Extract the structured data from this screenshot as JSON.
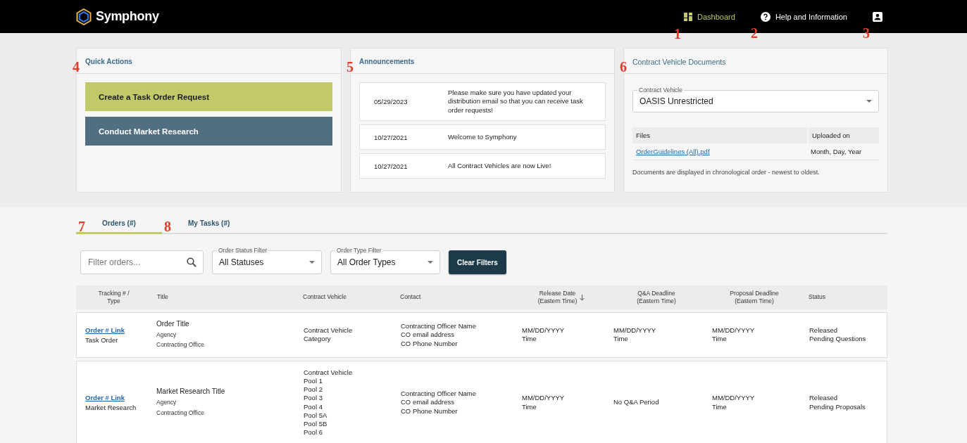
{
  "header": {
    "brand": "Symphony",
    "nav": [
      {
        "label": "Dashboard",
        "selected": true,
        "callout": "1"
      },
      {
        "label": "Help and Information",
        "selected": false,
        "callout": "2"
      },
      {
        "selected": false,
        "callout": "3"
      }
    ]
  },
  "quick_actions": {
    "title": "Quick Actions",
    "callout": "4",
    "buttons": [
      {
        "label": "Create a Task Order Request",
        "kind": "primary"
      },
      {
        "label": "Conduct Market Research",
        "kind": "secondary"
      }
    ]
  },
  "announcements": {
    "title": "Announcements",
    "callout": "5",
    "items": [
      {
        "date": "05/29/2023",
        "text": "Please make sure you have updated your distribution email so that you can receive task order requests!"
      },
      {
        "date": "10/27/2021",
        "text": "Welcome to Symphony"
      },
      {
        "date": "10/27/2021",
        "text": "All Contract Vehicles are now Live!"
      }
    ]
  },
  "documents": {
    "title": "Contract Vehicle Documents",
    "callout": "6",
    "select": {
      "label": "Contract Vehicle",
      "value": "OASIS Unrestricted"
    },
    "columns": [
      "Files",
      "Uploaded on"
    ],
    "files": [
      {
        "name": "OrderGuidelines (All).pdf",
        "uploaded": "Month, Day, Year"
      }
    ],
    "note": "Documents are displayed in chronological order - newest to oldest."
  },
  "tabs": [
    {
      "label": "Orders (#)",
      "selected": true,
      "callout": "7"
    },
    {
      "label": "My Tasks (#)",
      "selected": false,
      "callout": "8"
    }
  ],
  "filters": {
    "search": {
      "placeholder": "Filter orders..."
    },
    "selects": [
      {
        "label": "Order Status Filter",
        "value": "All Statuses"
      },
      {
        "label": "Order Type Filter",
        "value": "All Order Types"
      }
    ],
    "clear_button": "Clear Filters"
  },
  "table": {
    "columns": [
      {
        "label": "Tracking # /\nType",
        "sorted": false
      },
      {
        "label": "Title",
        "sorted": false
      },
      {
        "label": "Contract Vehicle",
        "sorted": false
      },
      {
        "label": "Contact",
        "sorted": false
      },
      {
        "label": "Release Date\n(Eastern Time)",
        "sorted": true
      },
      {
        "label": "Q&A Deadline\n(Eastern Time)",
        "sorted": false
      },
      {
        "label": "Proposal Deadline\n(Eastern Time)",
        "sorted": false
      },
      {
        "label": "Status",
        "sorted": false
      }
    ],
    "rows": [
      {
        "link": "Order # Link",
        "type": "Task Order",
        "title": "Order Title",
        "meta": "Agency\nContracting Office",
        "contract_vehicle": "Contract Vehicle\nCategory",
        "contact": "Contracting Officer Name\nCO email address\nCO Phone Number",
        "release": "MM/DD/YYYY\nTime",
        "qa": "MM/DD/YYYY\nTime",
        "proposal": "MM/DD/YYYY\nTime",
        "status": "Released\nPending Questions"
      },
      {
        "link": "Order # Link",
        "type": "Market Research",
        "title": "Market Research Title",
        "meta": "Agency\nContracting Office",
        "contract_vehicle": "Contract Vehicle\nPool 1\nPool 2\nPool 3\nPool 4\nPool 5A\nPool 5B\nPool 6",
        "contact": "Contracting Officer Name\nCO email address\nCO Phone Number",
        "release": "MM/DD/YYYY\nTime",
        "qa": "No Q&A Period",
        "proposal": "MM/DD/YYYY\nTime",
        "status": "Released\nPending Proposals"
      }
    ]
  }
}
